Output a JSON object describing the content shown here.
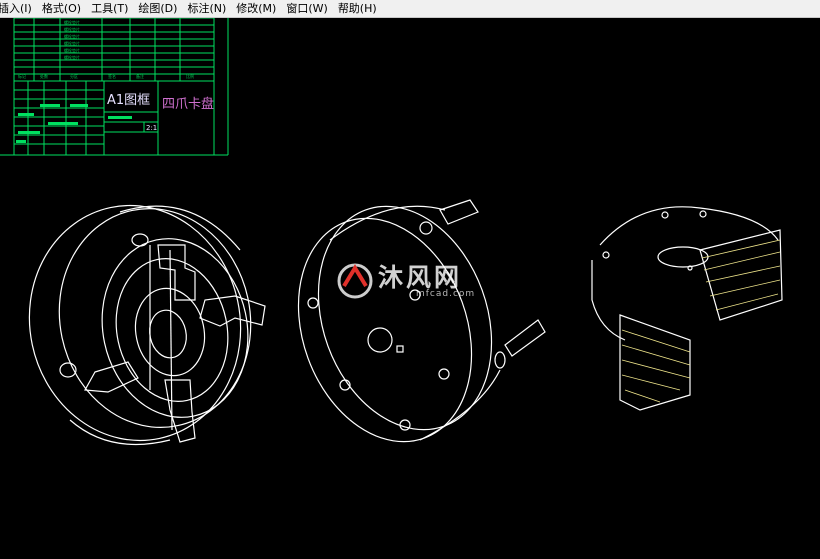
{
  "menubar": {
    "items": [
      {
        "label": "插入(I)"
      },
      {
        "label": "格式(O)"
      },
      {
        "label": "工具(T)"
      },
      {
        "label": "绘图(D)"
      },
      {
        "label": "标注(N)"
      },
      {
        "label": "修改(M)"
      },
      {
        "label": "窗口(W)"
      },
      {
        "label": "帮助(H)"
      }
    ]
  },
  "title_block": {
    "frame_label": "A1图框",
    "drawing_name": "四爪卡盘",
    "scale": "2:1"
  },
  "watermark": {
    "text": "沐风网",
    "url": "mfcad.com"
  },
  "colors": {
    "background": "#000000",
    "lines": "#ffffff",
    "title_block": "#00e060",
    "hatch": "#f0e68c",
    "title_text": "#d070d0"
  }
}
